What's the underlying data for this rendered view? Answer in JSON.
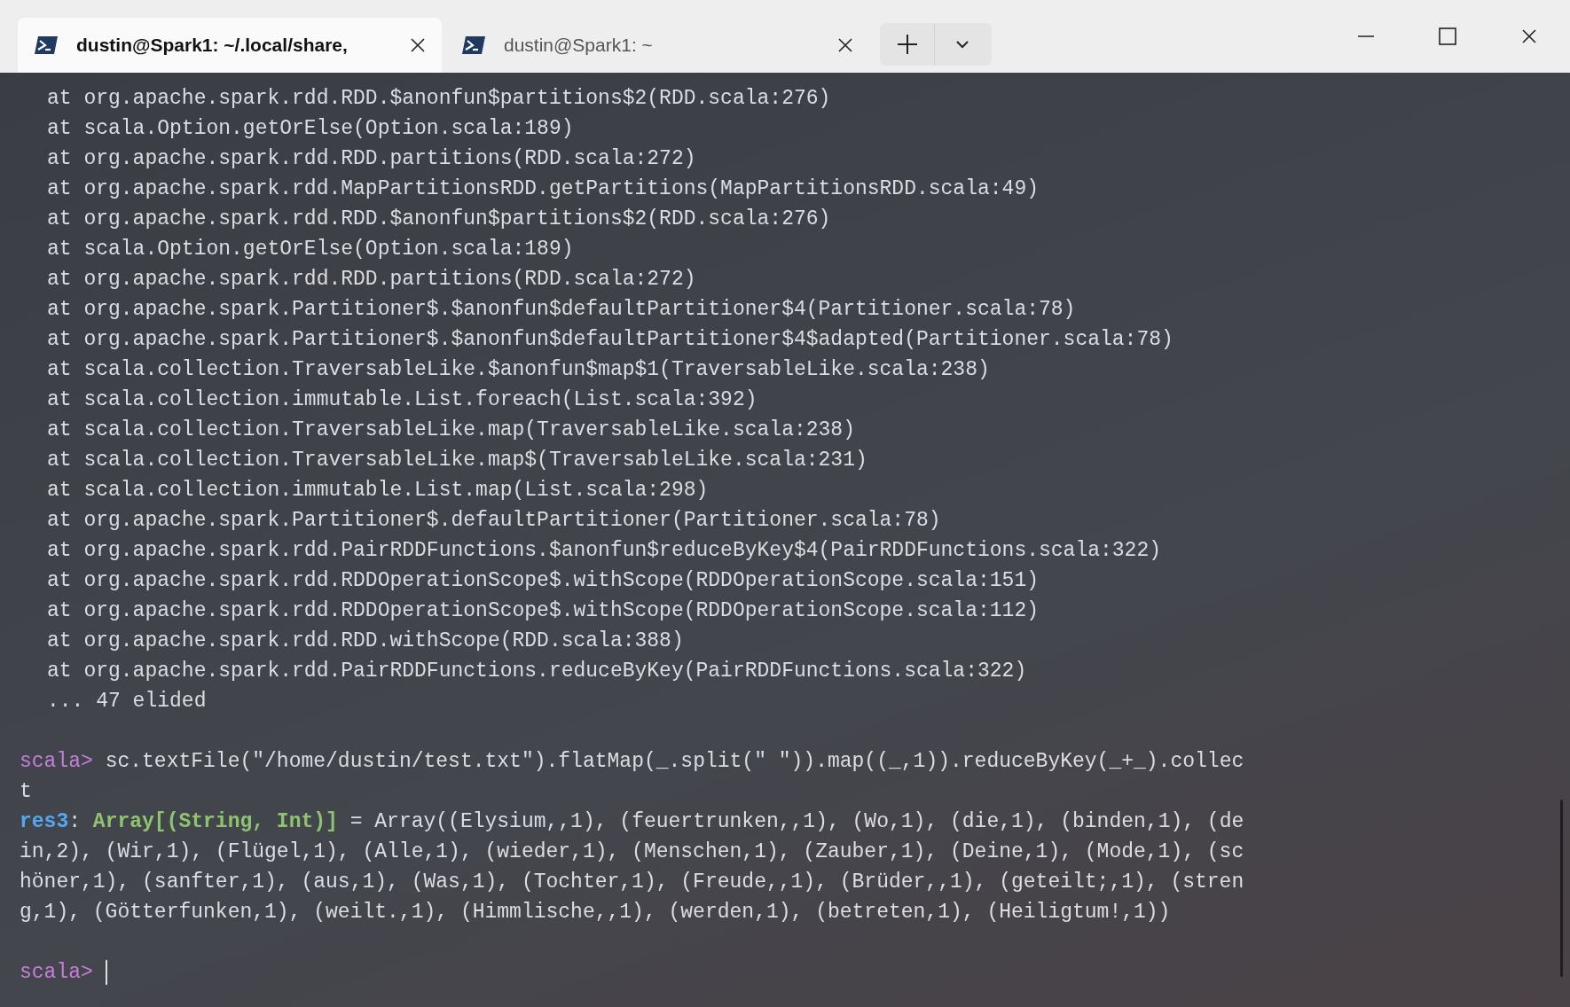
{
  "tabs": [
    {
      "title": "dustin@Spark1: ~/.local/share,",
      "selected": true
    },
    {
      "title": "dustin@Spark1: ~",
      "selected": false
    }
  ],
  "terminal": {
    "lines": [
      {
        "kind": "trace",
        "segments": [
          {
            "kind": "plain",
            "text": "at org.apache.spark.rdd.RDD.$anonfun$partitions$2(RDD.scala:276)"
          }
        ]
      },
      {
        "kind": "trace",
        "segments": [
          {
            "kind": "plain",
            "text": "at scala.Option.getOrElse(Option.scala:189)"
          }
        ]
      },
      {
        "kind": "trace",
        "segments": [
          {
            "kind": "plain",
            "text": "at org.apache.spark.rdd.RDD.partitions(RDD.scala:272)"
          }
        ]
      },
      {
        "kind": "trace",
        "segments": [
          {
            "kind": "plain",
            "text": "at org.apache.spark.rdd.MapPartitionsRDD.getPartitions(MapPartitionsRDD.scala:49)"
          }
        ]
      },
      {
        "kind": "trace",
        "segments": [
          {
            "kind": "plain",
            "text": "at org.apache.spark.rdd.RDD.$anonfun$partitions$2(RDD.scala:276)"
          }
        ]
      },
      {
        "kind": "trace",
        "segments": [
          {
            "kind": "plain",
            "text": "at scala.Option.getOrElse(Option.scala:189)"
          }
        ]
      },
      {
        "kind": "trace",
        "segments": [
          {
            "kind": "plain",
            "text": "at org.apache.spark.rdd.RDD.partitions(RDD.scala:272)"
          }
        ]
      },
      {
        "kind": "trace",
        "segments": [
          {
            "kind": "plain",
            "text": "at org.apache.spark.Partitioner$.$anonfun$defaultPartitioner$4(Partitioner.scala:78)"
          }
        ]
      },
      {
        "kind": "trace",
        "segments": [
          {
            "kind": "plain",
            "text": "at org.apache.spark.Partitioner$.$anonfun$defaultPartitioner$4$adapted(Partitioner.scala:78)"
          }
        ]
      },
      {
        "kind": "trace",
        "segments": [
          {
            "kind": "plain",
            "text": "at scala.collection.TraversableLike.$anonfun$map$1(TraversableLike.scala:238)"
          }
        ]
      },
      {
        "kind": "trace",
        "segments": [
          {
            "kind": "plain",
            "text": "at scala.collection.immutable.List.foreach(List.scala:392)"
          }
        ]
      },
      {
        "kind": "trace",
        "segments": [
          {
            "kind": "plain",
            "text": "at scala.collection.TraversableLike.map(TraversableLike.scala:238)"
          }
        ]
      },
      {
        "kind": "trace",
        "segments": [
          {
            "kind": "plain",
            "text": "at scala.collection.TraversableLike.map$(TraversableLike.scala:231)"
          }
        ]
      },
      {
        "kind": "trace",
        "segments": [
          {
            "kind": "plain",
            "text": "at scala.collection.immutable.List.map(List.scala:298)"
          }
        ]
      },
      {
        "kind": "trace",
        "segments": [
          {
            "kind": "plain",
            "text": "at org.apache.spark.Partitioner$.defaultPartitioner(Partitioner.scala:78)"
          }
        ]
      },
      {
        "kind": "trace",
        "segments": [
          {
            "kind": "plain",
            "text": "at org.apache.spark.rdd.PairRDDFunctions.$anonfun$reduceByKey$4(PairRDDFunctions.scala:322)"
          }
        ]
      },
      {
        "kind": "trace",
        "segments": [
          {
            "kind": "plain",
            "text": "at org.apache.spark.rdd.RDDOperationScope$.withScope(RDDOperationScope.scala:151)"
          }
        ]
      },
      {
        "kind": "trace",
        "segments": [
          {
            "kind": "plain",
            "text": "at org.apache.spark.rdd.RDDOperationScope$.withScope(RDDOperationScope.scala:112)"
          }
        ]
      },
      {
        "kind": "trace",
        "segments": [
          {
            "kind": "plain",
            "text": "at org.apache.spark.rdd.RDD.withScope(RDD.scala:388)"
          }
        ]
      },
      {
        "kind": "trace",
        "segments": [
          {
            "kind": "plain",
            "text": "at org.apache.spark.rdd.PairRDDFunctions.reduceByKey(PairRDDFunctions.scala:322)"
          }
        ]
      },
      {
        "kind": "trace",
        "segments": [
          {
            "kind": "plain",
            "text": "... 47 elided"
          }
        ]
      },
      {
        "kind": "blank"
      },
      {
        "kind": "line",
        "segments": [
          {
            "kind": "prompt",
            "text": "scala>"
          },
          {
            "kind": "plain",
            "text": " sc.textFile(\"/home/dustin/test.txt\").flatMap(_.split(\" \")).map((_,1)).reduceByKey(_+_).collec"
          }
        ]
      },
      {
        "kind": "line",
        "segments": [
          {
            "kind": "plain",
            "text": "t"
          }
        ]
      },
      {
        "kind": "line",
        "segments": [
          {
            "kind": "name",
            "text": "res3"
          },
          {
            "kind": "plain",
            "text": ": "
          },
          {
            "kind": "type",
            "text": "Array[(String, Int)]"
          },
          {
            "kind": "plain",
            "text": " = Array((Elysium,,1), (feuertrunken,,1), (Wo,1), (die,1), (binden,1), (de"
          }
        ]
      },
      {
        "kind": "line",
        "segments": [
          {
            "kind": "plain",
            "text": "in,2), (Wir,1), (Flügel,1), (Alle,1), (wieder,1), (Menschen,1), (Zauber,1), (Deine,1), (Mode,1), (sc"
          }
        ]
      },
      {
        "kind": "line",
        "segments": [
          {
            "kind": "plain",
            "text": "höner,1), (sanfter,1), (aus,1), (Was,1), (Tochter,1), (Freude,,1), (Brüder,,1), (geteilt;,1), (stren"
          }
        ]
      },
      {
        "kind": "line",
        "segments": [
          {
            "kind": "plain",
            "text": "g,1), (Götterfunken,1), (weilt.,1), (Himmlische,,1), (werden,1), (betreten,1), (Heiligtum!,1))"
          }
        ]
      },
      {
        "kind": "blank"
      },
      {
        "kind": "input",
        "segments": [
          {
            "kind": "prompt",
            "text": "scala>"
          }
        ]
      }
    ]
  }
}
